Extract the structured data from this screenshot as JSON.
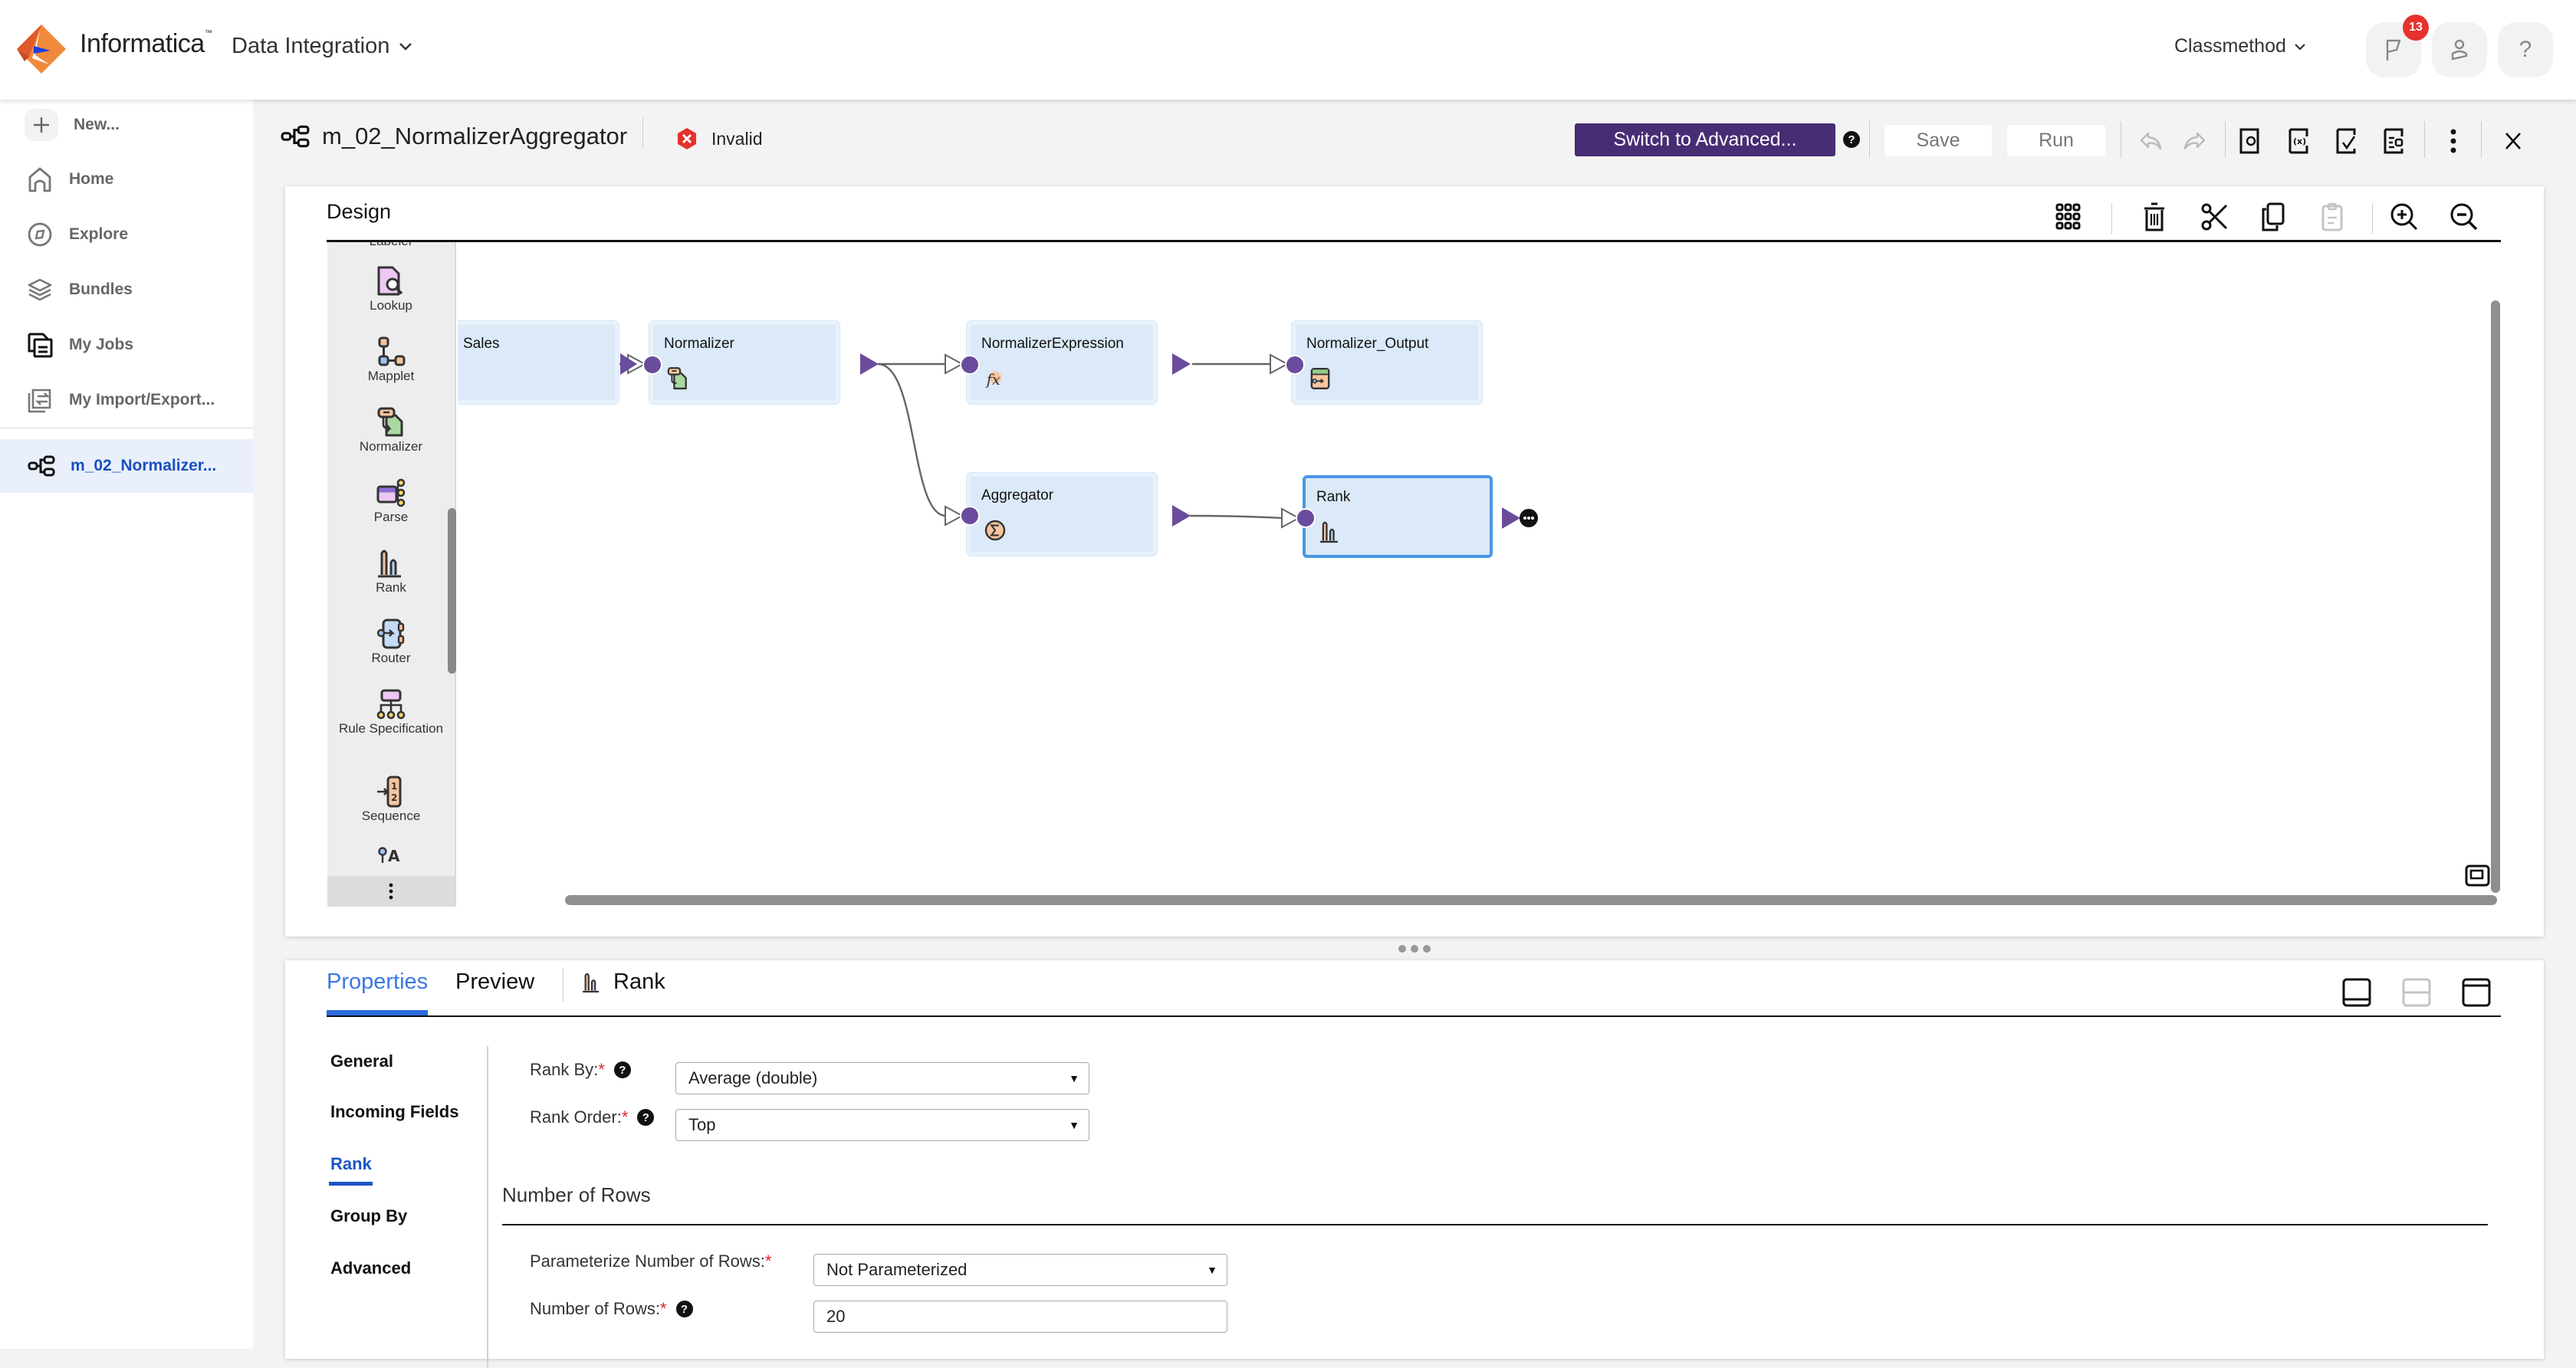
{
  "header": {
    "brand": "Informatica",
    "product": "Data Integration",
    "org": "Classmethod",
    "notification_count": "13",
    "icons": [
      "flag-icon",
      "user-icon",
      "help-icon"
    ]
  },
  "sidebar": {
    "items": [
      {
        "label": "New...",
        "icon": "plus-icon"
      },
      {
        "label": "Home",
        "icon": "home-icon"
      },
      {
        "label": "Explore",
        "icon": "compass-icon"
      },
      {
        "label": "Bundles",
        "icon": "layers-icon"
      },
      {
        "label": "My Jobs",
        "icon": "jobs-icon"
      },
      {
        "label": "My Import/Export...",
        "icon": "import-export-icon"
      }
    ],
    "open_asset": {
      "label": "m_02_Normalizer...",
      "icon": "mapping-icon"
    }
  },
  "titlebar": {
    "mapping_name": "m_02_NormalizerAggregator",
    "status": "Invalid",
    "switch_label": "Switch to Advanced...",
    "save_label": "Save",
    "run_label": "Run",
    "icons": [
      "undo-icon",
      "redo-icon",
      "add-parameter-icon",
      "in-out-parameters-icon",
      "validate-icon",
      "field-mapping-icon",
      "more-icon",
      "close-icon"
    ]
  },
  "design": {
    "title": "Design",
    "toolbar_icons": [
      "arrange-all-icon",
      "delete-icon",
      "cut-icon",
      "copy-icon",
      "paste-icon",
      "zoom-in-icon",
      "zoom-out-icon"
    ],
    "palette": [
      {
        "label": "Labeler"
      },
      {
        "label": "Lookup"
      },
      {
        "label": "Mapplet"
      },
      {
        "label": "Normalizer"
      },
      {
        "label": "Parse"
      },
      {
        "label": "Rank"
      },
      {
        "label": "Router"
      },
      {
        "label": "Rule Specification"
      },
      {
        "label": "Sequence"
      }
    ],
    "nodes": [
      {
        "name": "Sales",
        "icon": "source-icon"
      },
      {
        "name": "Normalizer",
        "icon": "normalizer-icon"
      },
      {
        "name": "NormalizerExpression",
        "icon": "expression-icon"
      },
      {
        "name": "Normalizer_Output",
        "icon": "target-icon"
      },
      {
        "name": "Aggregator",
        "icon": "aggregator-icon"
      },
      {
        "name": "Rank",
        "icon": "rank-icon",
        "selected": true
      }
    ],
    "links": [
      {
        "from": "Sales",
        "to": "Normalizer"
      },
      {
        "from": "Normalizer",
        "to": "NormalizerExpression"
      },
      {
        "from": "Normalizer",
        "to": "Aggregator"
      },
      {
        "from": "NormalizerExpression",
        "to": "Normalizer_Output"
      },
      {
        "from": "Aggregator",
        "to": "Rank"
      }
    ]
  },
  "properties": {
    "tabs": [
      {
        "label": "Properties",
        "active": true
      },
      {
        "label": "Preview"
      }
    ],
    "object_label": "Rank",
    "nav": [
      {
        "label": "General"
      },
      {
        "label": "Incoming Fields"
      },
      {
        "label": "Rank",
        "active": true
      },
      {
        "label": "Group By"
      },
      {
        "label": "Advanced"
      }
    ],
    "fields": {
      "rank_by": {
        "label": "Rank By:",
        "value": "Average (double)"
      },
      "rank_order": {
        "label": "Rank Order:",
        "value": "Top"
      },
      "section_title": "Number of Rows",
      "parameterize": {
        "label": "Parameterize Number of Rows:",
        "value": "Not Parameterized"
      },
      "num_rows": {
        "label": "Number of Rows:",
        "value": "20"
      }
    },
    "required_marker": "*",
    "help_glyph": "?"
  },
  "colors": {
    "accent": "#472d74",
    "link_blue": "#1b55c8",
    "tab_blue": "#3a78e0",
    "node_fill": "#dbe9f8",
    "port_purple": "#6a4c9c",
    "error_red": "#e5322d"
  }
}
